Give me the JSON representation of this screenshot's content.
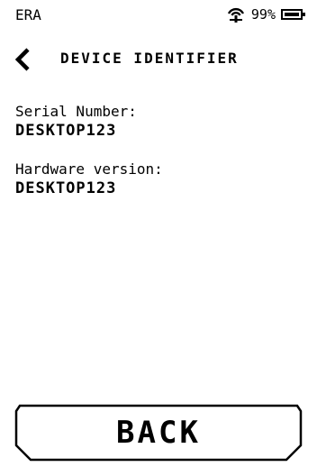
{
  "status_bar": {
    "carrier": "ERA",
    "battery_percent": "99%",
    "battery_level": 0.99,
    "icons": [
      "wifi-icon",
      "battery-icon"
    ]
  },
  "header": {
    "title": "DEVICE IDENTIFIER",
    "back_icon": "chevron-left-icon"
  },
  "fields": {
    "serial": {
      "label": "Serial Number:",
      "value": "DESKTOP123"
    },
    "hardware": {
      "label": "Hardware version:",
      "value": "DESKTOP123"
    }
  },
  "footer": {
    "back_label": "BACK"
  }
}
